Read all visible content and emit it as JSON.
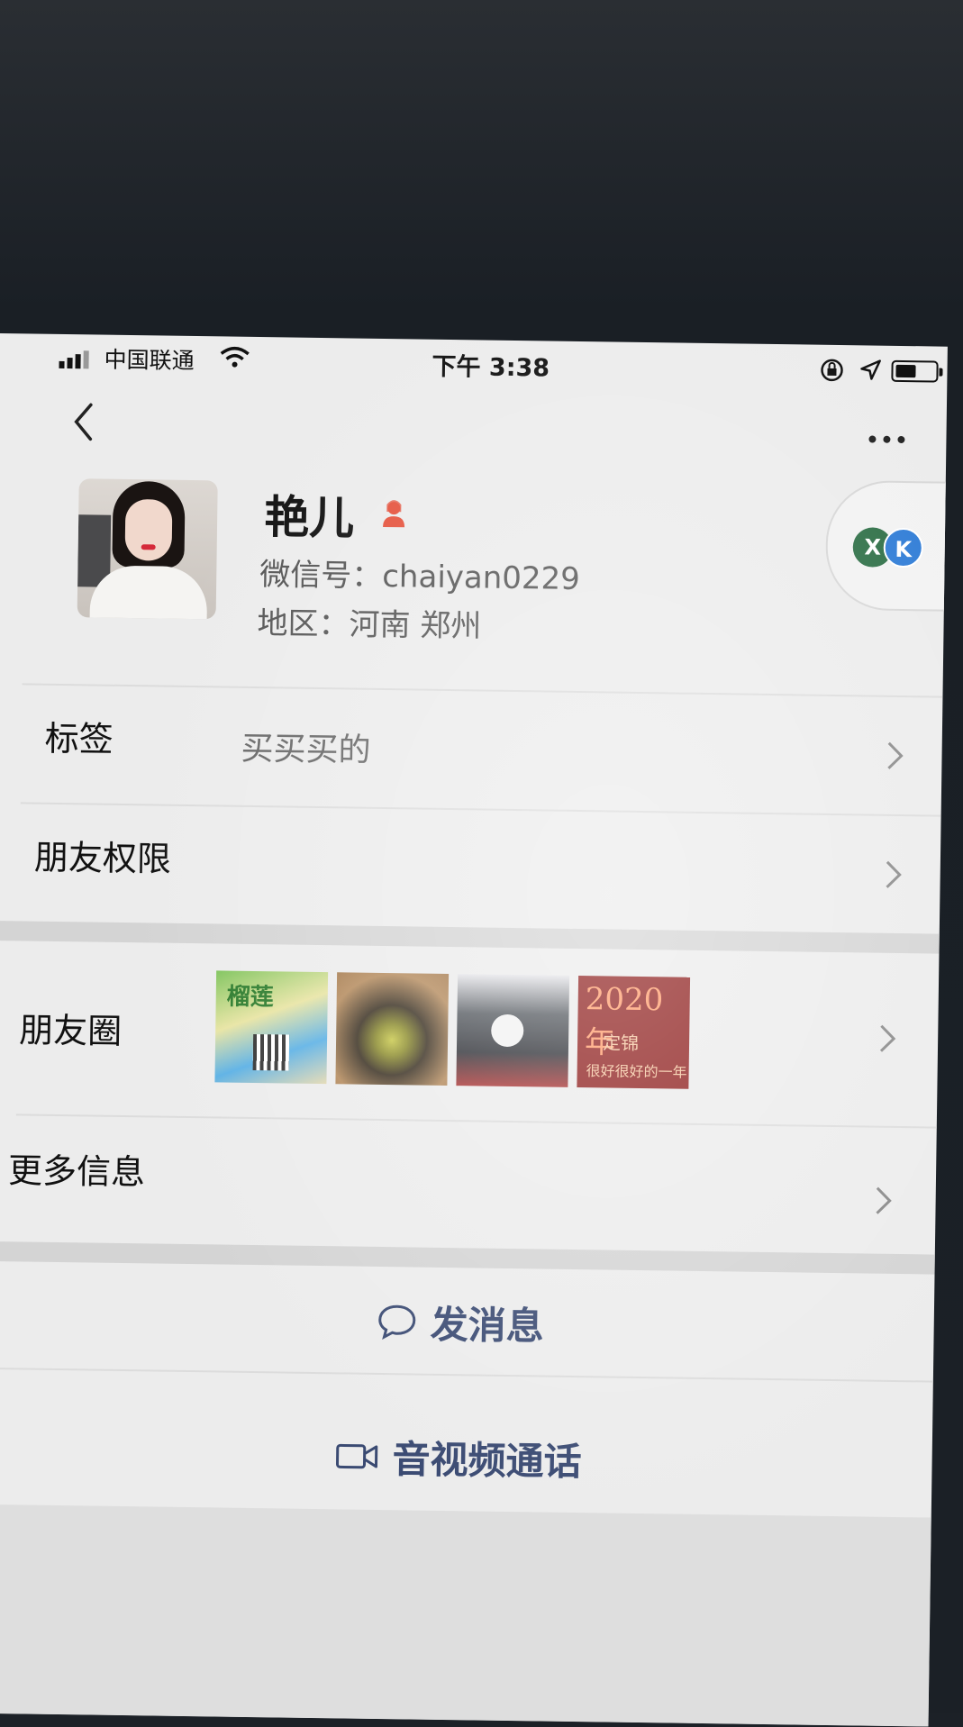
{
  "status_bar": {
    "carrier": "中国联通",
    "time": "下午 3:38"
  },
  "profile": {
    "nickname": "艳儿",
    "wechat_id": "微信号：chaiyan0229",
    "region": "地区：河南 郑州"
  },
  "rows": {
    "tags": {
      "label": "标签",
      "value": "买买买的"
    },
    "permissions": {
      "label": "朋友权限"
    },
    "moments": {
      "label": "朋友圈",
      "thumbnail_texts": {
        "t1": "榴莲",
        "t4_year": "2020年",
        "t4_line2": "定锦",
        "t4_line3": "很好很好的一年"
      }
    },
    "more_info": {
      "label": "更多信息"
    }
  },
  "actions": {
    "message": "发消息",
    "video_call": "音视频通话"
  },
  "colors": {
    "accent_text": "#3a4a72",
    "gender_female": "#e5533d"
  }
}
